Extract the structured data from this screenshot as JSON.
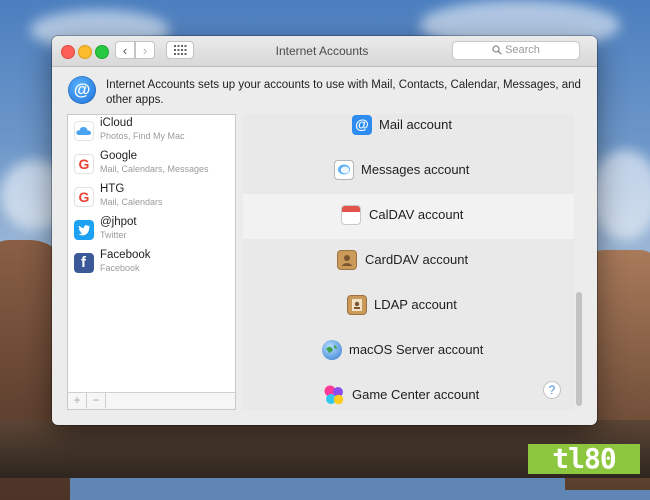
{
  "window": {
    "title": "Internet Accounts",
    "search_placeholder": "Search",
    "description": "Internet Accounts sets up your accounts to use with Mail, Contacts, Calendar, Messages, and other apps."
  },
  "accounts": [
    {
      "name": "iCloud",
      "detail": "Photos, Find My Mac",
      "icon": "icloud-icon"
    },
    {
      "name": "Google",
      "detail": "Mail, Calendars, Messages",
      "icon": "google-icon"
    },
    {
      "name": "HTG",
      "detail": "Mail, Calendars",
      "icon": "google-icon"
    },
    {
      "name": "@jhpot",
      "detail": "Twitter",
      "icon": "twitter-icon"
    },
    {
      "name": "Facebook",
      "detail": "Facebook",
      "icon": "facebook-icon"
    }
  ],
  "account_buttons": {
    "add": "+",
    "remove": "−"
  },
  "services": [
    {
      "label": "Mail account",
      "icon": "mail-icon"
    },
    {
      "label": "Messages account",
      "icon": "messages-icon"
    },
    {
      "label": "CalDAV account",
      "icon": "calendar-icon"
    },
    {
      "label": "CardDAV account",
      "icon": "contacts-icon"
    },
    {
      "label": "LDAP account",
      "icon": "directory-icon"
    },
    {
      "label": "macOS Server account",
      "icon": "server-globe-icon"
    },
    {
      "label": "Game Center account",
      "icon": "game-center-icon"
    }
  ],
  "help_label": "?",
  "watermark": "tl80",
  "colors": {
    "accent": "#1c6fd6",
    "watermark": "#8dc63f"
  }
}
